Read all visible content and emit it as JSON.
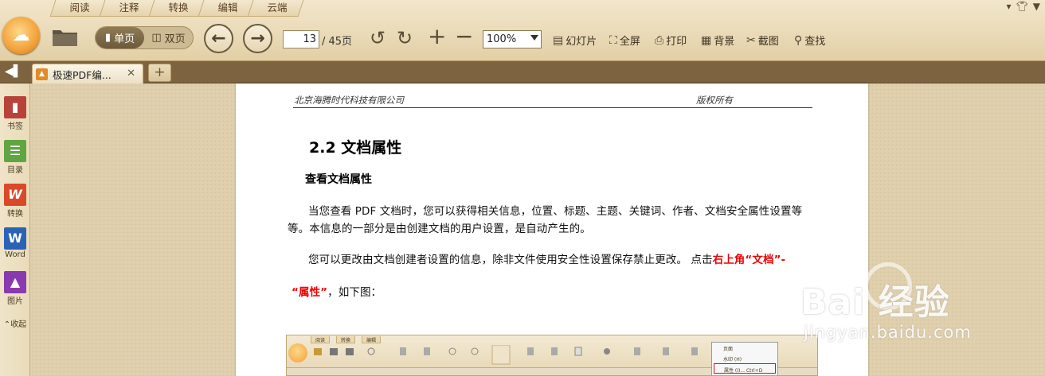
{
  "menu_tabs": [
    "阅读",
    "注释",
    "转换",
    "编辑",
    "云端"
  ],
  "window_controls": [
    "▾",
    "▼"
  ],
  "toolbar": {
    "single_page": "单页",
    "double_page": "双页",
    "current_page": "13",
    "total_pages": "/ 45页",
    "zoom": "100%",
    "slideshow": "幻灯片",
    "fullscreen": "全屏",
    "print": "打印",
    "background": "背景",
    "screenshot": "截图",
    "find": "查找"
  },
  "tab": {
    "title": "极速PDF编...",
    "add": "+"
  },
  "sidebar": {
    "items": [
      {
        "label": "书签",
        "icon": "bookmark-icon",
        "color": "#b8423a"
      },
      {
        "label": "目录",
        "icon": "toc-icon",
        "color": "#5fa640"
      },
      {
        "label": "转换",
        "icon": "convert-icon",
        "color": "#d84a2a"
      },
      {
        "label": "Word",
        "icon": "word-icon",
        "color": "#2a62b8"
      },
      {
        "label": "图片",
        "icon": "image-icon",
        "color": "#8a3ab0"
      }
    ],
    "collapse": "收起"
  },
  "document": {
    "header_left": "北京海腾时代科技有限公司",
    "header_right": "版权所有",
    "section_title": "2.2 文档属性",
    "subsection_title": "查看文档属性",
    "para1": "当您查看 PDF 文档时，您可以获得相关信息，位置、标题、主题、关键词、作者、文档安全属性设置等等。本信息的一部分是由创建文档的用户设置，是自动产生的。",
    "para2_normal": "您可以更改由文档创建者设置的信息，除非文件使用安全性设置保存禁止更改。  点击",
    "para2_red": "右上角“文档”-",
    "para3_red": "“属性”",
    "para3_normal": "，如下图："
  },
  "embedded_screenshot": {
    "tabs": [
      "阅读",
      "转换",
      "编辑"
    ],
    "menu_items": [
      "页面",
      "水印 (H)",
      "属性 (I)...   Ctrl+D"
    ]
  },
  "watermark": {
    "brand": "Bai  经验",
    "url": "jingyan.baidu.com"
  },
  "colors": {
    "accent_red": "#e00000",
    "tabbar_brown": "#7d6340",
    "toolbar_beige": "#eadab8"
  }
}
